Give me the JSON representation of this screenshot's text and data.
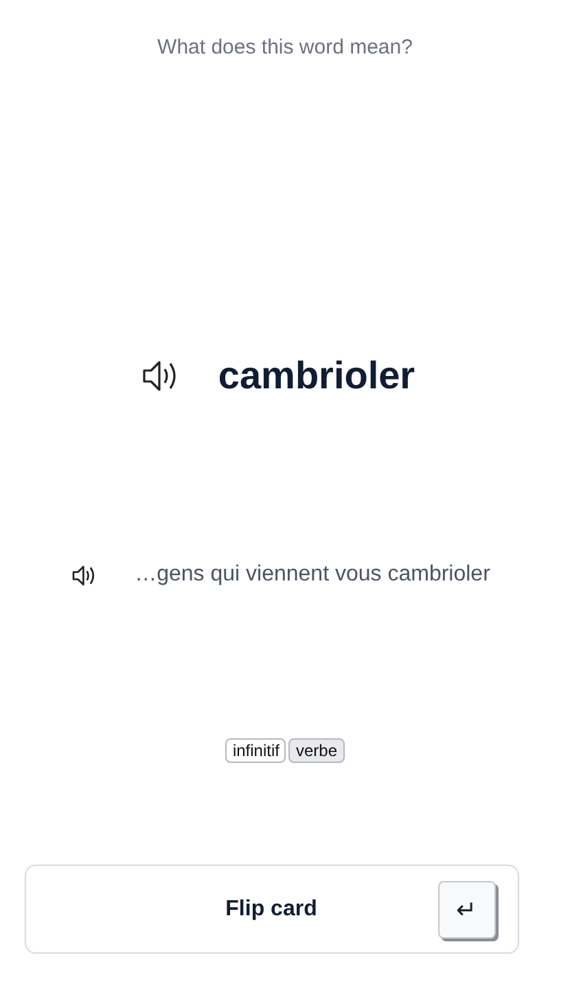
{
  "prompt": "What does this word mean?",
  "word": "cambrioler",
  "example": "…gens qui viennent vous cambrioler",
  "tags": [
    {
      "label": "infinitif",
      "color": "#ffffff"
    },
    {
      "label": "verbe",
      "color": "#e8e9ec"
    }
  ],
  "flip_button": {
    "label": "Flip card",
    "key": "↵"
  }
}
